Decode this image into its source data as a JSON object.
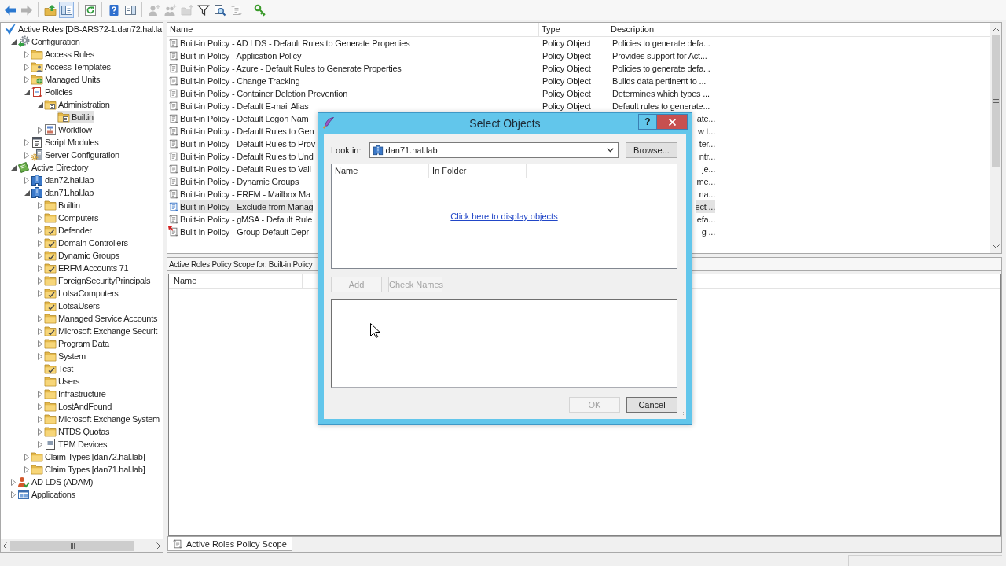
{
  "toolbar": [
    [
      {
        "kind": "back",
        "disabled": false,
        "pressed": false
      },
      {
        "kind": "forward",
        "disabled": true,
        "pressed": false
      }
    ],
    [
      {
        "kind": "up",
        "disabled": false,
        "pressed": false
      },
      {
        "kind": "tree",
        "disabled": false,
        "pressed": true
      }
    ],
    [
      {
        "kind": "refresh",
        "disabled": false,
        "pressed": false
      }
    ],
    [
      {
        "kind": "help",
        "disabled": false,
        "pressed": false
      },
      {
        "kind": "panel",
        "disabled": false,
        "pressed": false
      }
    ],
    [
      {
        "kind": "user",
        "disabled": true,
        "pressed": false
      },
      {
        "kind": "group",
        "disabled": true,
        "pressed": false
      },
      {
        "kind": "container",
        "disabled": true,
        "pressed": false
      },
      {
        "kind": "filter",
        "disabled": false,
        "pressed": false
      },
      {
        "kind": "find",
        "disabled": false,
        "pressed": false
      },
      {
        "kind": "scope",
        "disabled": true,
        "pressed": false
      }
    ],
    [
      {
        "kind": "key",
        "disabled": false,
        "pressed": false
      }
    ]
  ],
  "tree": [
    {
      "label": "Active Roles [DB-ARS72-1.dan72.hal.la",
      "kind": "root",
      "selected": false,
      "children": [
        {
          "label": "Configuration",
          "kind": "config",
          "expanded": true,
          "selected": false,
          "children": [
            {
              "label": "Access Rules",
              "kind": "folder",
              "expanded": false,
              "selected": false
            },
            {
              "label": "Access Templates",
              "kind": "template",
              "expanded": false,
              "selected": false
            },
            {
              "label": "Managed Units",
              "kind": "units",
              "expanded": false,
              "selected": false
            },
            {
              "label": "Policies",
              "kind": "policies",
              "expanded": true,
              "selected": false,
              "children": [
                {
                  "label": "Administration",
                  "kind": "policyfolder",
                  "expanded": true,
                  "selected": false,
                  "children": [
                    {
                      "label": "Builtin",
                      "kind": "policyfolder",
                      "selected": true
                    }
                  ]
                },
                {
                  "label": "Workflow",
                  "kind": "workflow",
                  "expanded": false,
                  "selected": false
                }
              ]
            },
            {
              "label": "Script Modules",
              "kind": "script",
              "expanded": false,
              "selected": false
            },
            {
              "label": "Server Configuration",
              "kind": "server",
              "expanded": false,
              "selected": false
            }
          ]
        },
        {
          "label": "Active Directory",
          "kind": "directory",
          "expanded": true,
          "selected": false,
          "children": [
            {
              "label": "dan72.hal.lab",
              "kind": "domain",
              "expanded": false,
              "selected": false
            },
            {
              "label": "dan71.hal.lab",
              "kind": "domain",
              "expanded": true,
              "selected": false,
              "children": [
                {
                  "label": "Builtin",
                  "kind": "folder",
                  "expanded": false,
                  "selected": false
                },
                {
                  "label": "Computers",
                  "kind": "folder",
                  "expanded": false,
                  "selected": false
                },
                {
                  "label": "Defender",
                  "kind": "ou",
                  "expanded": false,
                  "selected": false
                },
                {
                  "label": "Domain Controllers",
                  "kind": "ou",
                  "expanded": false,
                  "selected": false
                },
                {
                  "label": "Dynamic Groups",
                  "kind": "ou",
                  "expanded": false,
                  "selected": false
                },
                {
                  "label": "ERFM Accounts 71",
                  "kind": "ou",
                  "expanded": false,
                  "selected": false
                },
                {
                  "label": "ForeignSecurityPrincipals",
                  "kind": "folder",
                  "expanded": false,
                  "selected": false
                },
                {
                  "label": "LotsaComputers",
                  "kind": "ou",
                  "expanded": false,
                  "selected": false
                },
                {
                  "label": "LotsaUsers",
                  "kind": "ou",
                  "selected": false
                },
                {
                  "label": "Managed Service Accounts",
                  "kind": "folder",
                  "expanded": false,
                  "selected": false
                },
                {
                  "label": "Microsoft Exchange Securit",
                  "kind": "ou",
                  "expanded": false,
                  "selected": false
                },
                {
                  "label": "Program Data",
                  "kind": "folder",
                  "expanded": false,
                  "selected": false
                },
                {
                  "label": "System",
                  "kind": "folder",
                  "expanded": false,
                  "selected": false
                },
                {
                  "label": "Test",
                  "kind": "ou",
                  "selected": false
                },
                {
                  "label": "Users",
                  "kind": "folder",
                  "selected": false
                },
                {
                  "label": "Infrastructure",
                  "kind": "folder",
                  "expanded": false,
                  "selected": false
                },
                {
                  "label": "LostAndFound",
                  "kind": "folder",
                  "expanded": false,
                  "selected": false
                },
                {
                  "label": "Microsoft Exchange System",
                  "kind": "folder",
                  "expanded": false,
                  "selected": false
                },
                {
                  "label": "NTDS Quotas",
                  "kind": "folder",
                  "expanded": false,
                  "selected": false
                },
                {
                  "label": "TPM Devices",
                  "kind": "device",
                  "expanded": false,
                  "selected": false
                }
              ]
            },
            {
              "label": "Claim Types [dan72.hal.lab]",
              "kind": "folder",
              "expanded": false,
              "selected": false
            },
            {
              "label": "Claim Types [dan71.hal.lab]",
              "kind": "folder",
              "expanded": false,
              "selected": false
            }
          ]
        },
        {
          "label": "AD LDS (ADAM)",
          "kind": "adlds",
          "expanded": false,
          "selected": false
        },
        {
          "label": "Applications",
          "kind": "apps",
          "expanded": false,
          "selected": false
        }
      ]
    }
  ],
  "list": {
    "columns": [
      "Name",
      "Type",
      "Description"
    ],
    "rows": [
      {
        "name": "Built-in Policy - AD LDS - Default Rules to Generate Properties",
        "type": "Policy Object",
        "description": "Policies to generate defa...",
        "kind": "policy",
        "selected": false
      },
      {
        "name": "Built-in Policy - Application Policy",
        "type": "Policy Object",
        "description": "Provides support for Act...",
        "kind": "policy",
        "selected": false
      },
      {
        "name": "Built-in Policy - Azure - Default Rules to Generate Properties",
        "type": "Policy Object",
        "description": "Policies to generate defa...",
        "kind": "policy",
        "selected": false
      },
      {
        "name": "Built-in Policy - Change Tracking",
        "type": "Policy Object",
        "description": "Builds data pertinent to ...",
        "kind": "policy",
        "selected": false
      },
      {
        "name": "Built-in Policy - Container Deletion Prevention",
        "type": "Policy Object",
        "description": "Determines which types ...",
        "kind": "policy",
        "selected": false
      },
      {
        "name": "Built-in Policy - Default E-mail Alias",
        "type": "Policy Object",
        "description": "Default rules to generate...",
        "kind": "policy",
        "selected": false
      },
      {
        "name": "Built-in Policy - Default Logon Nam",
        "description": "ate...",
        "kind": "policy",
        "selected": false
      },
      {
        "name": "Built-in Policy - Default Rules to Gen",
        "description": "w t...",
        "kind": "policy",
        "selected": false
      },
      {
        "name": "Built-in Policy - Default Rules to Prov",
        "description": "ter...",
        "kind": "policy",
        "selected": false
      },
      {
        "name": "Built-in Policy - Default Rules to Und",
        "description": "ntr...",
        "kind": "policy",
        "selected": false
      },
      {
        "name": "Built-in Policy - Default Rules to Vali",
        "description": "je...",
        "kind": "policy",
        "selected": false
      },
      {
        "name": "Built-in Policy - Dynamic Groups",
        "description": "me...",
        "kind": "policy",
        "selected": false
      },
      {
        "name": "Built-in Policy - ERFM - Mailbox Ma",
        "description": "na...",
        "kind": "policy",
        "selected": false
      },
      {
        "name": "Built-in Policy - Exclude from Manag",
        "description": "ect ...",
        "kind": "policy",
        "selected": true
      },
      {
        "name": "Built-in Policy - gMSA - Default Rule",
        "description": "efa...",
        "kind": "policy",
        "selected": false
      },
      {
        "name": "Built-in Policy - Group Default Depr",
        "description": "g ...",
        "kind": "flagged",
        "selected": false
      }
    ]
  },
  "scope_pane": {
    "header": "Active Roles Policy Scope for: Built-in Policy",
    "columns": [
      "Name"
    ],
    "tabs": [
      {
        "label": "Active Roles Policy Scope",
        "selected": true
      }
    ]
  },
  "dialog": {
    "title": "Select Objects",
    "help_button": "?",
    "look_in_label": "Look in:",
    "look_in_value": "dan71.hal.lab",
    "browse_button": {
      "label": "Browse...",
      "disabled": false
    },
    "columns": [
      "Name",
      "In Folder"
    ],
    "link": "Click here to display objects",
    "add_button": {
      "label": "Add",
      "disabled": true
    },
    "check_names_button": {
      "label": "Check Names",
      "disabled": true
    },
    "ok_button": {
      "label": "OK",
      "disabled": true
    },
    "cancel_button": {
      "label": "Cancel",
      "disabled": false
    }
  }
}
